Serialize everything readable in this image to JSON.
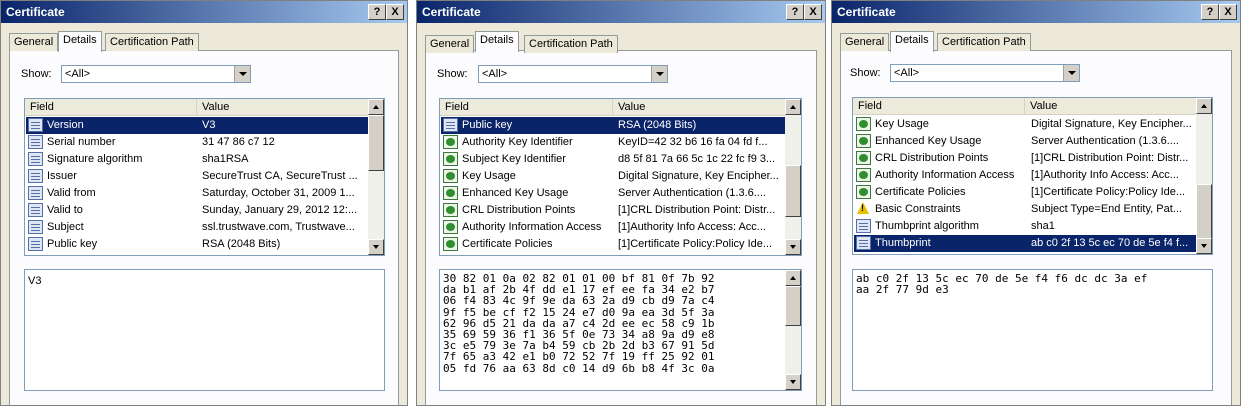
{
  "dialogs": [
    {
      "title": "Certificate",
      "tabs": [
        "General",
        "Details",
        "Certification Path"
      ],
      "active_tab": 1,
      "show_label": "Show:",
      "show_value": "<All>",
      "columns": [
        "Field",
        "Value"
      ],
      "rows": [
        {
          "field": "Version",
          "value": "V3",
          "icon": "field-icon",
          "selected": true
        },
        {
          "field": "Serial number",
          "value": "31 47 86 c7 12",
          "icon": "field-icon"
        },
        {
          "field": "Signature algorithm",
          "value": "sha1RSA",
          "icon": "field-icon"
        },
        {
          "field": "Issuer",
          "value": "SecureTrust CA, SecureTrust ...",
          "icon": "field-icon"
        },
        {
          "field": "Valid from",
          "value": "Saturday, October 31, 2009 1...",
          "icon": "field-icon"
        },
        {
          "field": "Valid to",
          "value": "Sunday, January 29, 2012 12:...",
          "icon": "field-icon"
        },
        {
          "field": "Subject",
          "value": "ssl.trustwave.com, Trustwave...",
          "icon": "field-icon"
        },
        {
          "field": "Public key",
          "value": "RSA (2048 Bits)",
          "icon": "field-icon"
        }
      ],
      "detail": "V3"
    },
    {
      "title": "Certificate",
      "tabs": [
        "General",
        "Details",
        "Certification Path"
      ],
      "active_tab": 1,
      "show_label": "Show:",
      "show_value": "<All>",
      "columns": [
        "Field",
        "Value"
      ],
      "rows": [
        {
          "field": "Public key",
          "value": "RSA (2048 Bits)",
          "icon": "field-icon",
          "selected": true
        },
        {
          "field": "Authority Key Identifier",
          "value": "KeyID=42 32 b6 16 fa 04 fd f...",
          "icon": "extension-icon"
        },
        {
          "field": "Subject Key Identifier",
          "value": "d8 5f 81 7a 66 5c 1c 22 fc f9 3...",
          "icon": "extension-icon"
        },
        {
          "field": "Key Usage",
          "value": "Digital Signature, Key Encipher...",
          "icon": "extension-icon"
        },
        {
          "field": "Enhanced Key Usage",
          "value": "Server Authentication (1.3.6....",
          "icon": "extension-icon"
        },
        {
          "field": "CRL Distribution Points",
          "value": "[1]CRL Distribution Point: Distr...",
          "icon": "extension-icon"
        },
        {
          "field": "Authority Information Access",
          "value": "[1]Authority Info Access: Acc...",
          "icon": "extension-icon"
        },
        {
          "field": "Certificate Policies",
          "value": "[1]Certificate Policy:Policy Ide...",
          "icon": "extension-icon"
        }
      ],
      "detail_lines": [
        "30 82 01 0a 02 82 01 01 00 bf 81 0f 7b 92",
        "da b1 af 2b 4f dd e1 17 ef ee fa 34 e2 b7",
        "06 f4 83 4c 9f 9e da 63 2a d9 cb d9 7a c4",
        "9f f5 be cf f2 15 24 e7 d0 9a ea 3d 5f 3a",
        "62 96 d5 21 da da a7 c4 2d ee ec 58 c9 1b",
        "35 69 59 36 f1 36 5f 0e 73 34 a8 9a d9 e8",
        "3c e5 79 3e 7a b4 59 cb 2b 2d b3 67 91 5d",
        "7f 65 a3 42 e1 b0 72 52 7f 19 ff 25 92 01",
        "05 fd 76 aa 63 8d c0 14 d9 6b b8 4f 3c 0a"
      ]
    },
    {
      "title": "Certificate",
      "tabs": [
        "General",
        "Details",
        "Certification Path"
      ],
      "active_tab": 1,
      "show_label": "Show:",
      "show_value": "<All>",
      "columns": [
        "Field",
        "Value"
      ],
      "rows": [
        {
          "field": "Key Usage",
          "value": "Digital Signature, Key Encipher...",
          "icon": "extension-icon"
        },
        {
          "field": "Enhanced Key Usage",
          "value": "Server Authentication (1.3.6....",
          "icon": "extension-icon"
        },
        {
          "field": "CRL Distribution Points",
          "value": "[1]CRL Distribution Point: Distr...",
          "icon": "extension-icon"
        },
        {
          "field": "Authority Information Access",
          "value": "[1]Authority Info Access: Acc...",
          "icon": "extension-icon"
        },
        {
          "field": "Certificate Policies",
          "value": "[1]Certificate Policy:Policy Ide...",
          "icon": "extension-icon"
        },
        {
          "field": "Basic Constraints",
          "value": "Subject Type=End Entity, Pat...",
          "icon": "warning-icon"
        },
        {
          "field": "Thumbprint algorithm",
          "value": "sha1",
          "icon": "field-icon"
        },
        {
          "field": "Thumbprint",
          "value": "ab c0 2f 13 5c ec 70 de 5e f4 f...",
          "icon": "field-icon",
          "selected": true
        }
      ],
      "detail_lines": [
        "ab c0 2f 13 5c ec 70 de 5e f4 f6 dc dc 3a ef",
        "aa 2f 77 9d e3"
      ]
    }
  ],
  "icons": {
    "help": "?",
    "close": "X"
  },
  "colors": {
    "selection": "#0a246a",
    "titlebar": "#0a246a"
  }
}
